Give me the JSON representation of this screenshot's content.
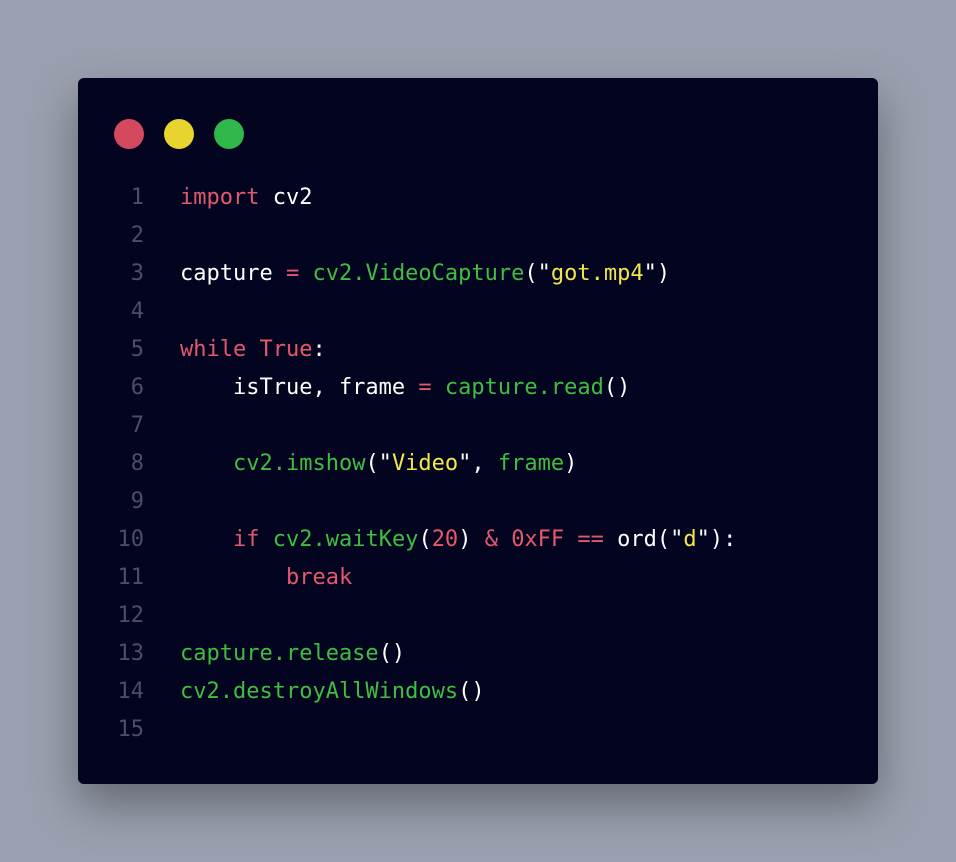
{
  "window": {
    "dots": [
      {
        "name": "close-dot",
        "color": "#d5495f"
      },
      {
        "name": "minimize-dot",
        "color": "#e8d42e"
      },
      {
        "name": "zoom-dot",
        "color": "#2fb74a"
      }
    ]
  },
  "colors": {
    "keyword": "#e2586d",
    "function": "#3fbe3f",
    "string": "#f1e64a",
    "text": "#ffffff",
    "line_number": "#4b4f63",
    "background": "#030420"
  },
  "code": {
    "lines": [
      {
        "n": "1",
        "tokens": [
          {
            "t": "kw",
            "v": "import"
          },
          {
            "t": "tx",
            "v": " cv2"
          }
        ]
      },
      {
        "n": "2",
        "tokens": []
      },
      {
        "n": "3",
        "tokens": [
          {
            "t": "tx",
            "v": "capture "
          },
          {
            "t": "op",
            "v": "="
          },
          {
            "t": "tx",
            "v": " "
          },
          {
            "t": "fn",
            "v": "cv2.VideoCapture"
          },
          {
            "t": "pn",
            "v": "(\""
          },
          {
            "t": "st",
            "v": "got.mp4"
          },
          {
            "t": "pn",
            "v": "\")"
          }
        ]
      },
      {
        "n": "4",
        "tokens": []
      },
      {
        "n": "5",
        "tokens": [
          {
            "t": "kw",
            "v": "while"
          },
          {
            "t": "tx",
            "v": " "
          },
          {
            "t": "nm",
            "v": "True"
          },
          {
            "t": "pn",
            "v": ":"
          }
        ]
      },
      {
        "n": "6",
        "tokens": [
          {
            "t": "tx",
            "v": "    isTrue, frame "
          },
          {
            "t": "op",
            "v": "="
          },
          {
            "t": "tx",
            "v": " "
          },
          {
            "t": "fn",
            "v": "capture.read"
          },
          {
            "t": "pn",
            "v": "()"
          }
        ]
      },
      {
        "n": "7",
        "tokens": []
      },
      {
        "n": "8",
        "tokens": [
          {
            "t": "tx",
            "v": "    "
          },
          {
            "t": "fn",
            "v": "cv2.imshow"
          },
          {
            "t": "pn",
            "v": "(\""
          },
          {
            "t": "st",
            "v": "Video"
          },
          {
            "t": "pn",
            "v": "\", "
          },
          {
            "t": "fn",
            "v": "frame"
          },
          {
            "t": "pn",
            "v": ")"
          }
        ]
      },
      {
        "n": "9",
        "tokens": []
      },
      {
        "n": "10",
        "tokens": [
          {
            "t": "tx",
            "v": "    "
          },
          {
            "t": "kw",
            "v": "if"
          },
          {
            "t": "tx",
            "v": " "
          },
          {
            "t": "fn",
            "v": "cv2.waitKey"
          },
          {
            "t": "pn",
            "v": "("
          },
          {
            "t": "nm",
            "v": "20"
          },
          {
            "t": "pn",
            "v": ") "
          },
          {
            "t": "op",
            "v": "&"
          },
          {
            "t": "tx",
            "v": " "
          },
          {
            "t": "nm",
            "v": "0xFF"
          },
          {
            "t": "tx",
            "v": " "
          },
          {
            "t": "op",
            "v": "=="
          },
          {
            "t": "tx",
            "v": " ord"
          },
          {
            "t": "pn",
            "v": "(\""
          },
          {
            "t": "st",
            "v": "d"
          },
          {
            "t": "pn",
            "v": "\"):"
          }
        ]
      },
      {
        "n": "11",
        "tokens": [
          {
            "t": "tx",
            "v": "        "
          },
          {
            "t": "kw",
            "v": "break"
          }
        ]
      },
      {
        "n": "12",
        "tokens": []
      },
      {
        "n": "13",
        "tokens": [
          {
            "t": "fn",
            "v": "capture.release"
          },
          {
            "t": "pn",
            "v": "()"
          }
        ]
      },
      {
        "n": "14",
        "tokens": [
          {
            "t": "fn",
            "v": "cv2.destroyAllWindows"
          },
          {
            "t": "pn",
            "v": "()"
          }
        ]
      },
      {
        "n": "15",
        "tokens": []
      }
    ]
  }
}
